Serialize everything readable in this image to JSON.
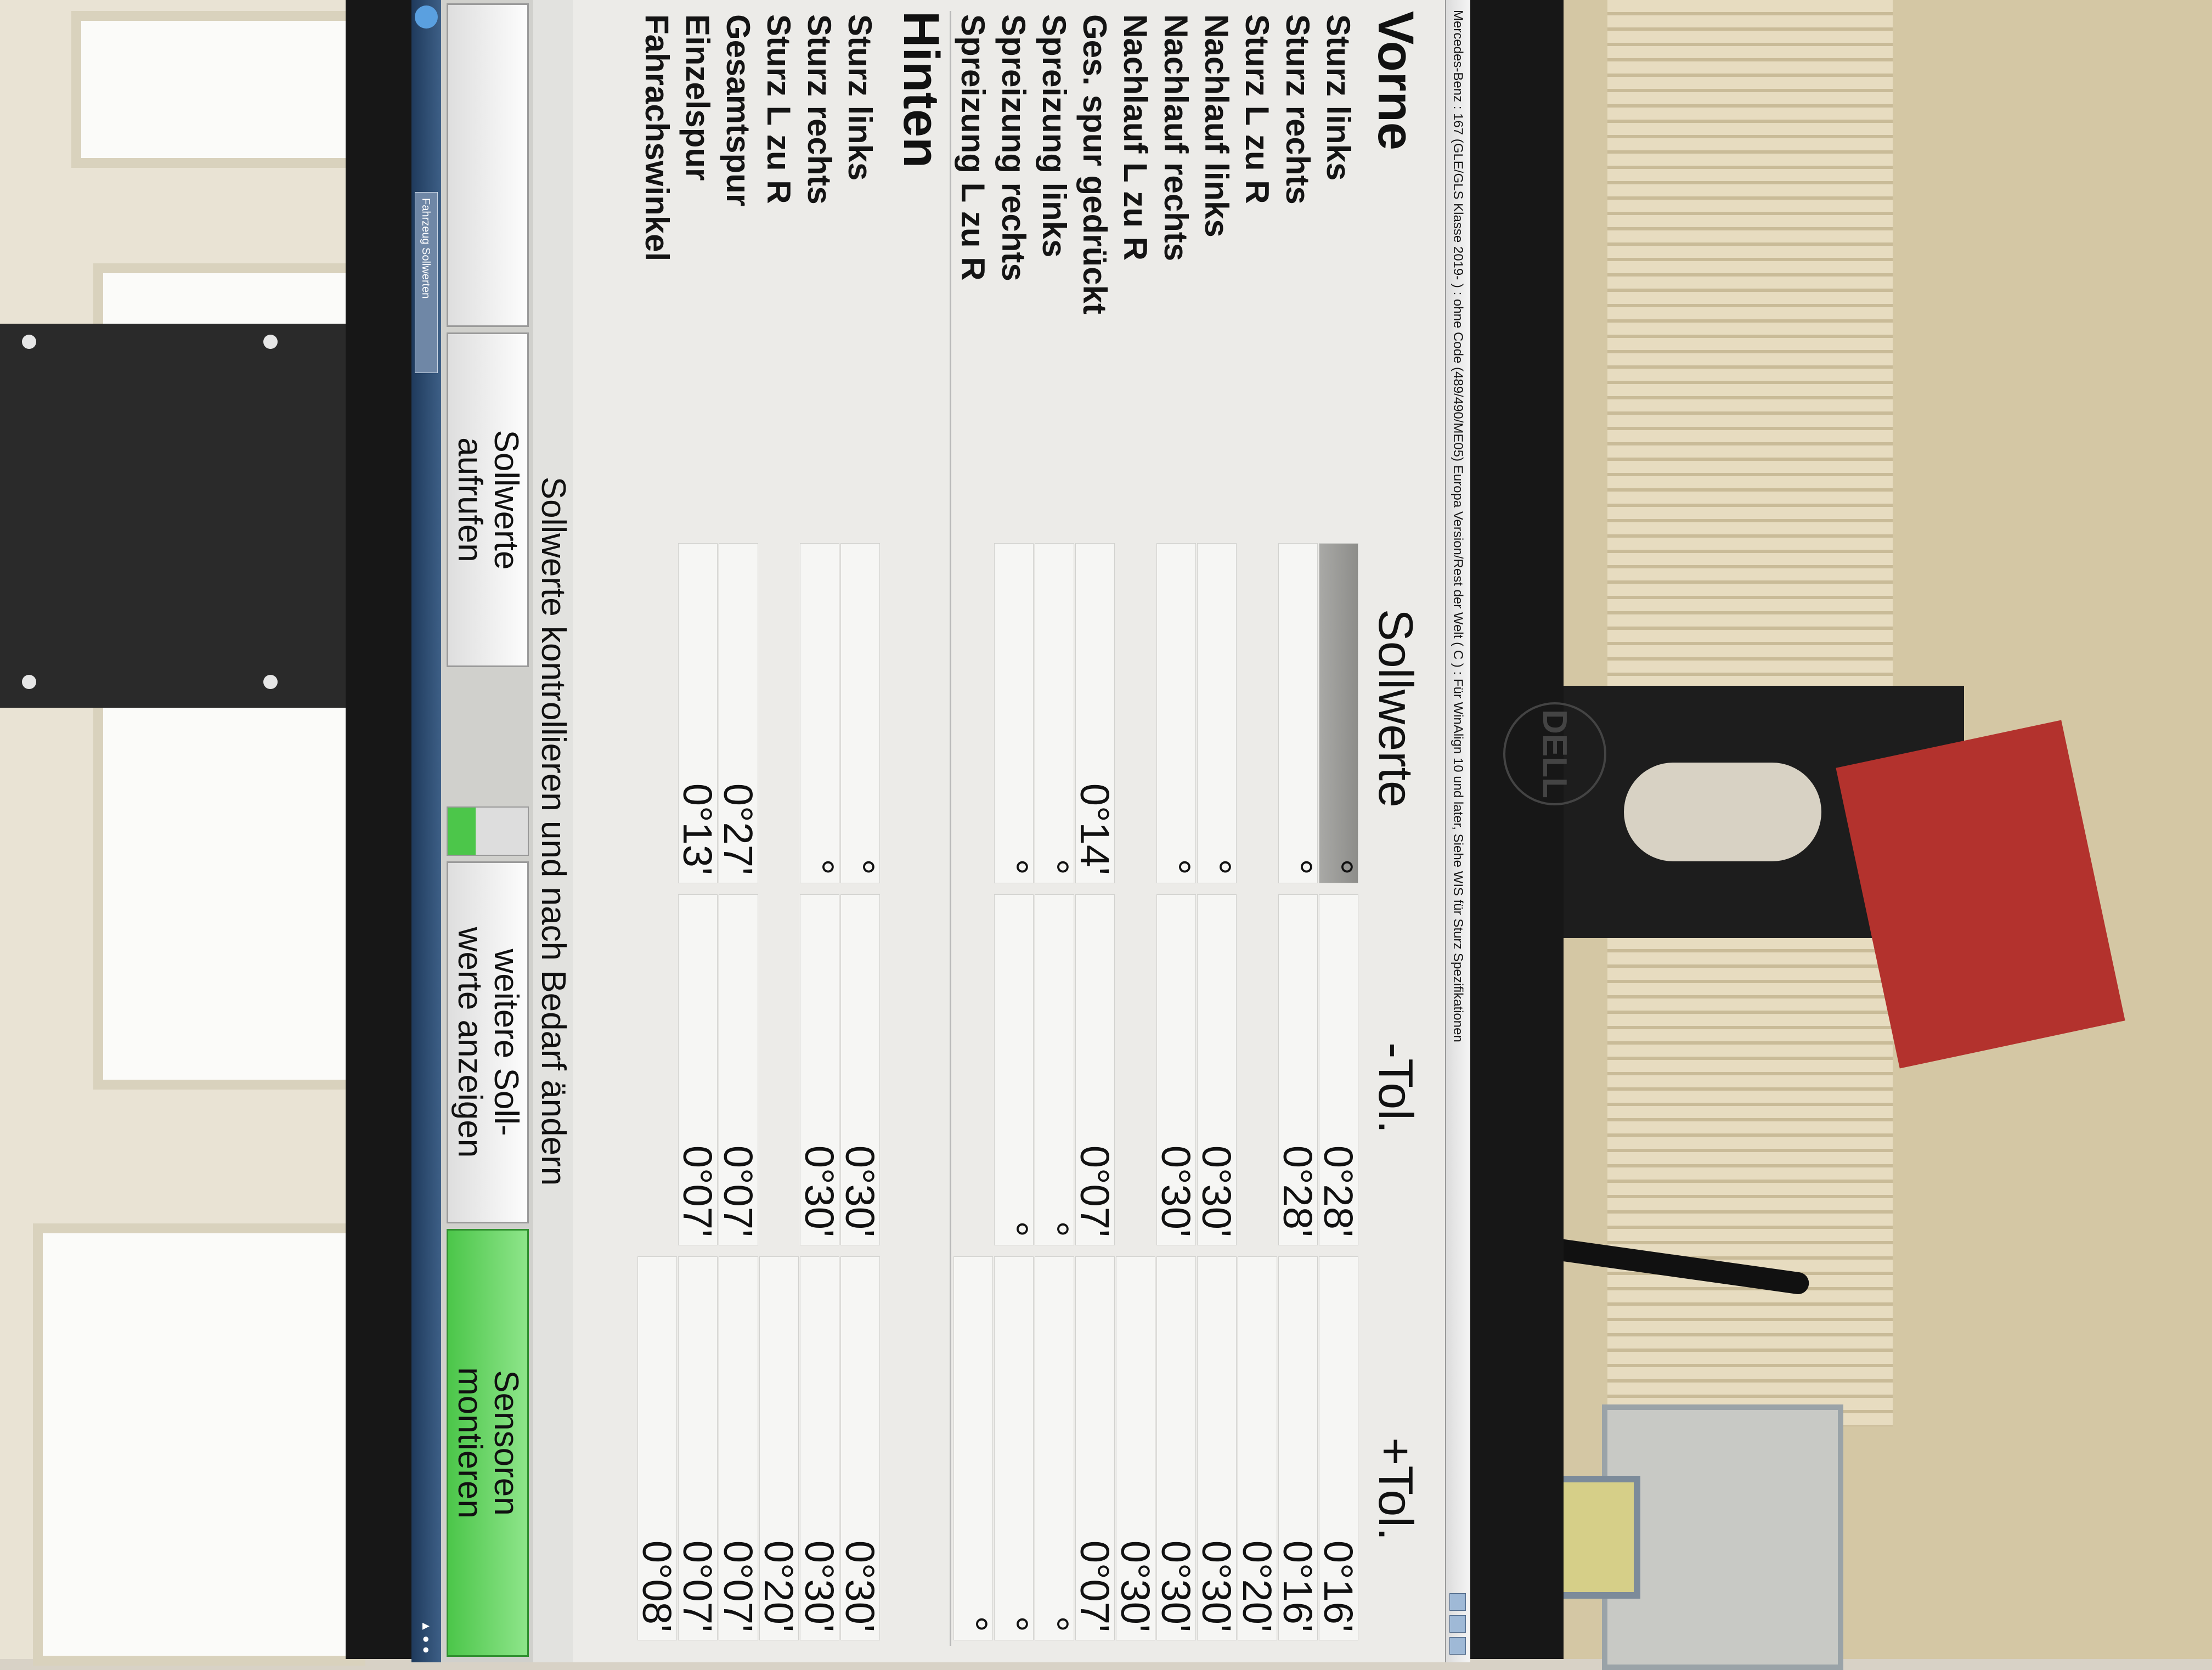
{
  "window": {
    "title": "Mercedes-Benz : 167 (GLE/GLS Klasse 2019- ) : ohne Code (489/490/ME05) Europa Version/Rest der Welt ( C ) : Für WinAlign 10 und later, Siehe WIS für Sturz Spezifikationen"
  },
  "columns": {
    "sollwerte": "Sollwerte",
    "minus_tol": "-Tol.",
    "plus_tol": "+Tol."
  },
  "vorne": {
    "title": "Vorne",
    "rows": [
      {
        "label": "Sturz links",
        "soll": "°",
        "minus": "0°28'",
        "plus": "0°16'"
      },
      {
        "label": "Sturz rechts",
        "soll": "°",
        "minus": "0°28'",
        "plus": "0°16'"
      },
      {
        "label": "Sturz  L zu R",
        "soll": "",
        "minus": "",
        "plus": "0°20'"
      },
      {
        "label": "Nachlauf links",
        "soll": "°",
        "minus": "0°30'",
        "plus": "0°30'"
      },
      {
        "label": "Nachlauf rechts",
        "soll": "°",
        "minus": "0°30'",
        "plus": "0°30'"
      },
      {
        "label": "Nachlauf  L zu R",
        "soll": "",
        "minus": "",
        "plus": "0°30'"
      },
      {
        "label": "Ges. spur gedrückt",
        "soll": "0°14'",
        "minus": "0°07'",
        "plus": "0°07'"
      },
      {
        "label": "Spreizung links",
        "soll": "°",
        "minus": "°",
        "plus": "°"
      },
      {
        "label": "Spreizung rechts",
        "soll": "°",
        "minus": "°",
        "plus": "°"
      },
      {
        "label": "Spreizung L zu R",
        "soll": "",
        "minus": "",
        "plus": "°"
      }
    ]
  },
  "hinten": {
    "title": "Hinten",
    "rows": [
      {
        "label": "Sturz links",
        "soll": "°",
        "minus": "0°30'",
        "plus": "0°30'"
      },
      {
        "label": "Sturz rechts",
        "soll": "°",
        "minus": "0°30'",
        "plus": "0°30'"
      },
      {
        "label": "Sturz  L zu R",
        "soll": "",
        "minus": "",
        "plus": "0°20'"
      },
      {
        "label": "Gesamtspur",
        "soll": "0°27'",
        "minus": "0°07'",
        "plus": "0°07'"
      },
      {
        "label": "Einzelspur",
        "soll": "0°13'",
        "minus": "0°07'",
        "plus": "0°07'"
      },
      {
        "label": "Fahrachswinkel",
        "soll": "",
        "minus": "",
        "plus": "0°08'"
      }
    ]
  },
  "instruction": "Sollwerte kontrollieren und nach Bedarf ändern",
  "buttons": {
    "b1": "",
    "b2_line1": "Sollwerte",
    "b2_line2": "aufrufen",
    "b3_line1": "weitere Soll-",
    "b3_line2": "werte anzeigen",
    "b4_line1": "Sensoren",
    "b4_line2": "montieren"
  },
  "progress_fraction": 0.35,
  "taskbar": {
    "task_label": "Fahrzeug Sollwerten"
  },
  "monitor_brand": "DELL",
  "colors": {
    "green_button": "#4cc64a",
    "selected_cell": "#8d8d8a",
    "taskbar": "#1f3a5c"
  }
}
